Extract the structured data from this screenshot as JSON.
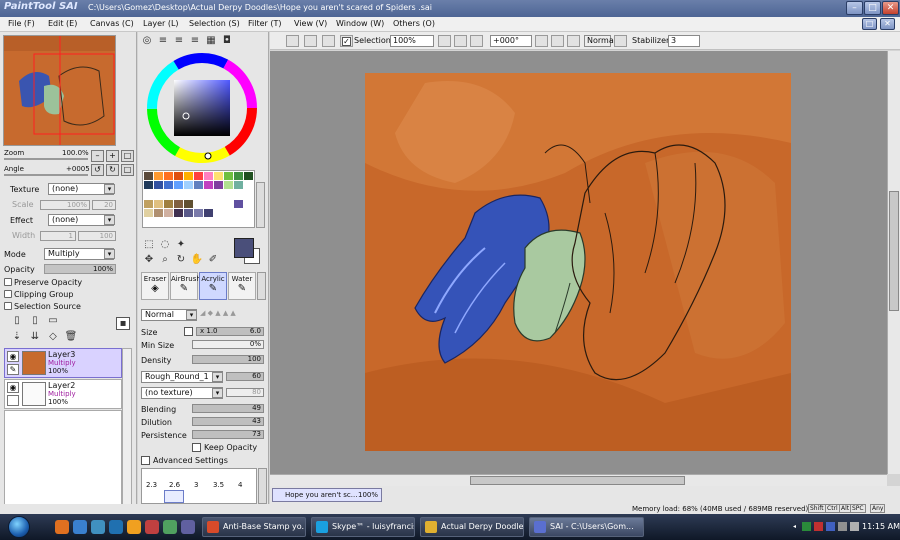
{
  "window": {
    "app_logo": "PaintTool SAI",
    "title": "C:\\Users\\Gomez\\Desktop\\Actual Derpy Doodles\\Hope you aren't scared of Spiders .sai",
    "controls": {
      "minimize": "–",
      "maximize": "□",
      "close": "✕"
    }
  },
  "menu": [
    {
      "label": "File (F)"
    },
    {
      "label": "Edit (E)"
    },
    {
      "label": "Canvas (C)"
    },
    {
      "label": "Layer (L)"
    },
    {
      "label": "Selection (S)"
    },
    {
      "label": "Filter (T)"
    },
    {
      "label": "View (V)"
    },
    {
      "label": "Window (W)"
    },
    {
      "label": "Others (O)"
    }
  ],
  "toolbar": {
    "selection_label": "Selection",
    "selection_checked": true,
    "zoom_value": "100%",
    "angle_value": "+000°",
    "blend_value": "Normal",
    "stabilizer_label": "Stabilizer",
    "stabilizer_value": "3"
  },
  "navigator": {
    "zoom_label": "Zoom",
    "zoom_value": "100.0%",
    "angle_label": "Angle",
    "angle_value": "+0005"
  },
  "texture": {
    "texture_label": "Texture",
    "texture_value": "(none)",
    "scale_label": "Scale",
    "scale_value": "100%",
    "scale_num": "20",
    "effect_label": "Effect",
    "effect_value": "(none)",
    "width_label": "Width",
    "width_value": "1",
    "width_num": "100"
  },
  "layer_props": {
    "mode_label": "Mode",
    "mode_value": "Multiply",
    "opacity_label": "Opacity",
    "opacity_value": "100%",
    "preserve_opacity": "Preserve Opacity",
    "clipping_group": "Clipping Group",
    "selection_source": "Selection Source"
  },
  "layers": [
    {
      "name": "Layer3",
      "mode": "Multiply",
      "opacity": "100%",
      "selected": true
    },
    {
      "name": "Layer2",
      "mode": "Multiply",
      "opacity": "100%",
      "selected": false
    }
  ],
  "brushes": [
    {
      "label": "Eraser"
    },
    {
      "label": "AirBrush"
    },
    {
      "label": "Acrylic"
    },
    {
      "label": "Water"
    }
  ],
  "brush_settings": {
    "blend_mode": "Normal",
    "size_label": "Size",
    "size_mult": "x 1.0",
    "size_value": "6.0",
    "min_size_label": "Min Size",
    "min_size_value": "0%",
    "density_label": "Density",
    "density_value": "100",
    "shape_value": "Rough_Round_1",
    "shape_num": "60",
    "texture_value": "(no texture)",
    "texture_num": "80",
    "blending_label": "Blending",
    "blending_value": "49",
    "dilution_label": "Dilution",
    "dilution_value": "43",
    "persistence_label": "Persistence",
    "persistence_value": "73",
    "keep_opacity": "Keep Opacity",
    "advanced_settings": "Advanced Settings",
    "size_presets": [
      "2.3",
      "2.6",
      "3",
      "3.5",
      "4"
    ]
  },
  "colors": {
    "primary": "#4a4f7a",
    "canvas_bg": "#c8682a",
    "accent": "#7a6fd0"
  },
  "doc_tab": {
    "label": "Hope you aren't sc...",
    "zoom": "100%"
  },
  "status": {
    "memory": "Memory load: 68% (40MB used / 689MB reserved)",
    "keys": [
      "Shift",
      "Ctrl",
      "Alt",
      "SPC",
      "Any"
    ]
  },
  "taskbar": {
    "items": [
      {
        "label": "Anti-Base Stamp yo...",
        "color": "#d84b2a"
      },
      {
        "label": "Skype™ - luisyfrancis",
        "color": "#1aa0e0"
      },
      {
        "label": "Actual Derpy Doodles",
        "color": "#e0b030"
      },
      {
        "label": "SAI - C:\\Users\\Gom...",
        "color": "#5a6fd0"
      }
    ],
    "clock": "11:15 AM"
  }
}
